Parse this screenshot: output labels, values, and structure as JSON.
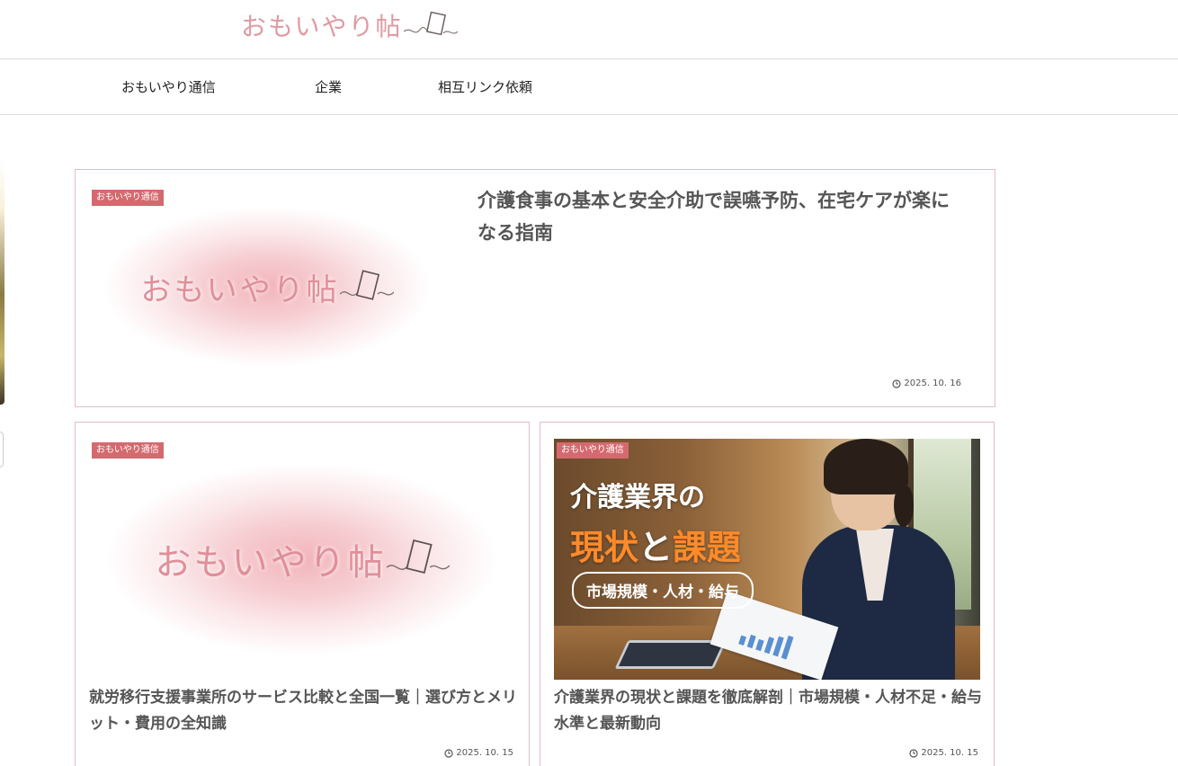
{
  "header": {
    "logo_text": "おもいやり帖"
  },
  "nav": {
    "items": [
      {
        "label": "おもいやり通信"
      },
      {
        "label": "企業"
      },
      {
        "label": "相互リンク依頼"
      }
    ]
  },
  "posts": [
    {
      "category": "おもいやり通信",
      "thumb_logo_text": "おもいやり帖",
      "title": "介護食事の基本と安全介助で誤嚥予防、在宅ケアが楽になる指南",
      "date": "2025. 10. 16"
    },
    {
      "category": "おもいやり通信",
      "thumb_logo_text": "おもいやり帖",
      "title": "就労移行支援事業所のサービス比較と全国一覧｜選び方とメリット・費用の全知識",
      "date": "2025. 10. 15"
    },
    {
      "category": "おもいやり通信",
      "thumb_overlay": {
        "line1": "介護業界の",
        "line2_a": "現状",
        "line2_b": "と",
        "line2_c": "課題",
        "pill": "市場規模・人材・給与"
      },
      "title": "介護業界の現状と課題を徹底解剖｜市場規模・人材不足・給与水準と最新動向",
      "date": "2025. 10. 15"
    }
  ],
  "colors": {
    "badge": "#d46a6f",
    "card_border": "#e5bcc4",
    "logo_pink": "#e09aa2",
    "accent_orange": "#ff8a2a"
  }
}
